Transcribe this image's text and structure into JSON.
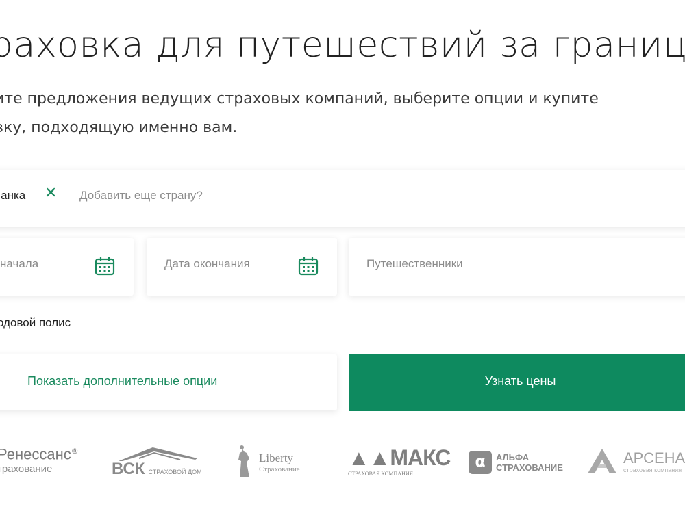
{
  "header": {
    "title": "раховка для путешествий за границу",
    "subtitle_line1": "ите предложения ведущих страховых компаний, выберите опции и купите",
    "subtitle_line2": "вку, подходящую именно вам."
  },
  "form": {
    "country_chip": "Ланка",
    "add_country_placeholder": "Добавить еще страну?",
    "date_start_placeholder": "начала",
    "date_end_placeholder": "Дата окончания",
    "travelers_placeholder": "Путешественники",
    "annual_policy_label": "одовой полис",
    "show_options_label": "Показать дополнительные опции",
    "get_prices_label": "Узнать цены"
  },
  "colors": {
    "accent": "#0e8a5f",
    "accent_text": "#1a8a5e"
  },
  "partners": [
    {
      "name_line1": "Ренессанс",
      "name_line2": "трахование",
      "mark": "®"
    },
    {
      "name_line1": "ВСК",
      "name_line2": "СТРАХОВОЙ ДОМ"
    },
    {
      "name_line1": "Liberty",
      "name_line2": "Страхование"
    },
    {
      "name_line1": "МАКС",
      "name_line2": "СТРАХОВАЯ КОМПАНИЯ"
    },
    {
      "name_line1": "АЛЬФА",
      "name_line2": "СТРАХОВАНИЕ"
    },
    {
      "name_line1": "АРСЕНАЛ",
      "name_line2": "страховая компания"
    }
  ]
}
